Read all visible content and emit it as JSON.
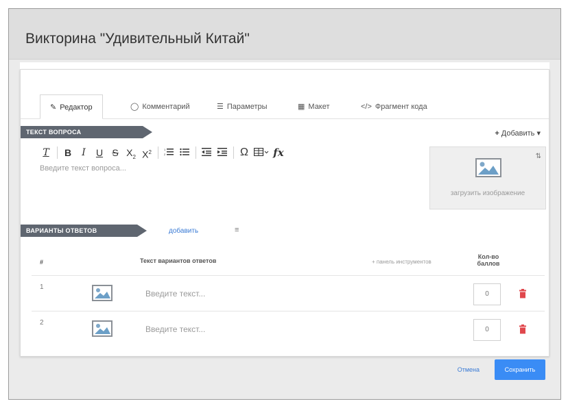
{
  "window": {
    "title": "Викторина \"Удивительный Китай\""
  },
  "tabs": [
    {
      "label": "Редактор",
      "icon": "edit-icon",
      "active": true
    },
    {
      "label": "Комментарий",
      "icon": "comment-icon",
      "active": false
    },
    {
      "label": "Параметры",
      "icon": "sliders-icon",
      "active": false
    },
    {
      "label": "Макет",
      "icon": "layout-icon",
      "active": false
    },
    {
      "label": "Фрагмент кода",
      "icon": "code-icon",
      "active": false
    }
  ],
  "question": {
    "section_label": "Текст вопроса",
    "add_label": "Добавить",
    "placeholder": "Введите текст вопроса...",
    "image_upload_label": "загрузить изображение"
  },
  "toolbar": {
    "buttons": [
      "Tx",
      "B",
      "I",
      "U",
      "S",
      "X₂",
      "X²",
      "numbered-list",
      "bulleted-list",
      "outdent",
      "indent",
      "Ω",
      "table",
      "fx"
    ]
  },
  "answers": {
    "section_label": "Варианты ответов",
    "add_label": "добавить",
    "columns": {
      "number": "#",
      "text": "Текст вариантов ответов",
      "instruments": "+ панель инструментов",
      "score": "Кол-во баллов"
    },
    "rows": [
      {
        "number": "1",
        "placeholder": "Введите текст...",
        "score": "0"
      },
      {
        "number": "2",
        "placeholder": "Введите текст...",
        "score": "0"
      }
    ]
  },
  "footer": {
    "cancel_label": "Отмена",
    "save_label": "Сохранить"
  },
  "colors": {
    "ribbon": "#5f6670",
    "accent": "#3a8cf5",
    "delete": "#e0474c"
  }
}
